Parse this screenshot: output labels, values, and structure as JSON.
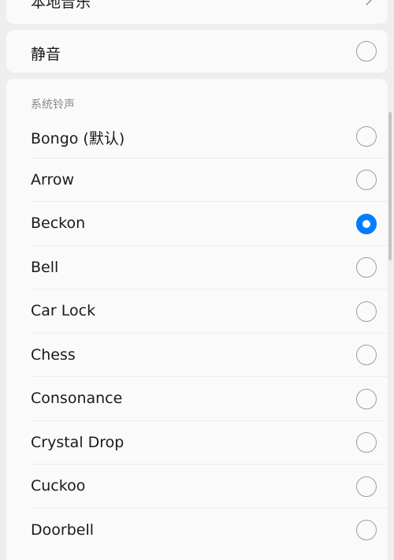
{
  "top_item": {
    "label": "本地音乐",
    "icon": "chevron-right-icon"
  },
  "mute": {
    "label": "静音",
    "checked": false
  },
  "section": {
    "title": "系统铃声"
  },
  "ringtones": [
    {
      "label": "Bongo (默认)",
      "checked": false
    },
    {
      "label": "Arrow",
      "checked": false
    },
    {
      "label": "Beckon",
      "checked": true
    },
    {
      "label": "Bell",
      "checked": false
    },
    {
      "label": "Car Lock",
      "checked": false
    },
    {
      "label": "Chess",
      "checked": false
    },
    {
      "label": "Consonance",
      "checked": false
    },
    {
      "label": "Crystal Drop",
      "checked": false
    },
    {
      "label": "Cuckoo",
      "checked": false
    },
    {
      "label": "Doorbell",
      "checked": false
    }
  ],
  "colors": {
    "accent": "#007dff",
    "background": "#eeeeee",
    "card": "#fafafa",
    "text": "#1a1a1a",
    "secondary_text": "#8a8a8a"
  }
}
